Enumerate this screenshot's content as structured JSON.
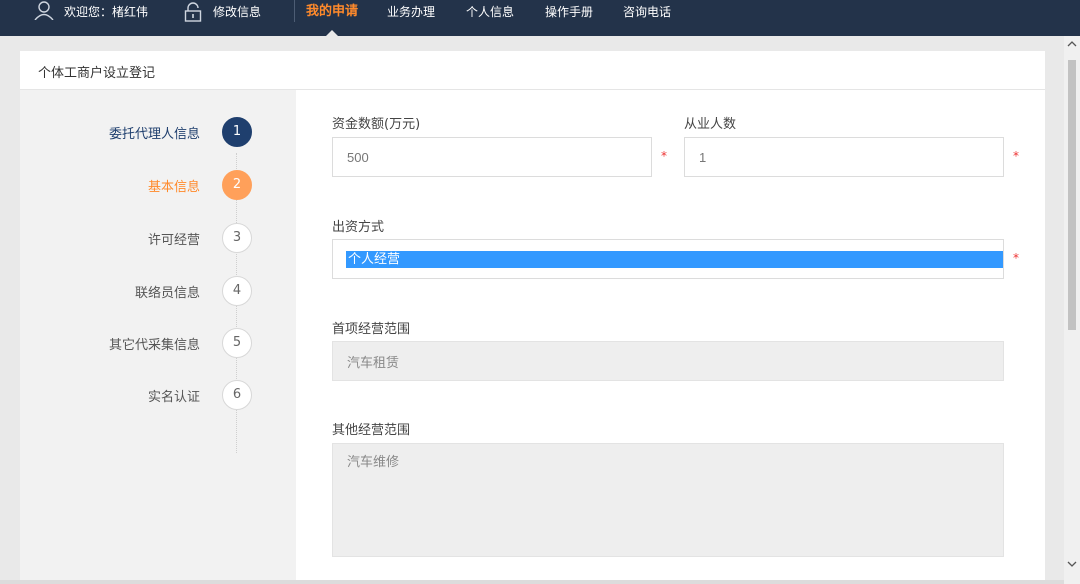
{
  "topbar": {
    "welcome": "欢迎您：楮红伟",
    "edit_info": "修改信息",
    "nav": [
      "我的申请",
      "业务办理",
      "个人信息",
      "操作手册",
      "咨询电话"
    ],
    "active_color": "#ff8a2b",
    "bg_color": "#23334a"
  },
  "panel": {
    "title": "个体工商户设立登记"
  },
  "steps": [
    {
      "label": "委托代理人信息",
      "num": "1",
      "state": "done"
    },
    {
      "label": "基本信息",
      "num": "2",
      "state": "current"
    },
    {
      "label": "许可经营",
      "num": "3",
      "state": "todo"
    },
    {
      "label": "联络员信息",
      "num": "4",
      "state": "todo"
    },
    {
      "label": "其它代采集信息",
      "num": "5",
      "state": "todo"
    },
    {
      "label": "实名认证",
      "num": "6",
      "state": "todo"
    }
  ],
  "form": {
    "capital_label": "资金数额(万元)",
    "capital_value": "500",
    "employees_label": "从业人数",
    "employees_value": "1",
    "funding_label": "出资方式",
    "funding_value": "个人经营",
    "primary_scope_label": "首项经营范围",
    "primary_scope_value": "汽车租赁",
    "other_scope_label": "其他经营范围",
    "other_scope_value": "汽车维修",
    "required_mark": "*"
  }
}
